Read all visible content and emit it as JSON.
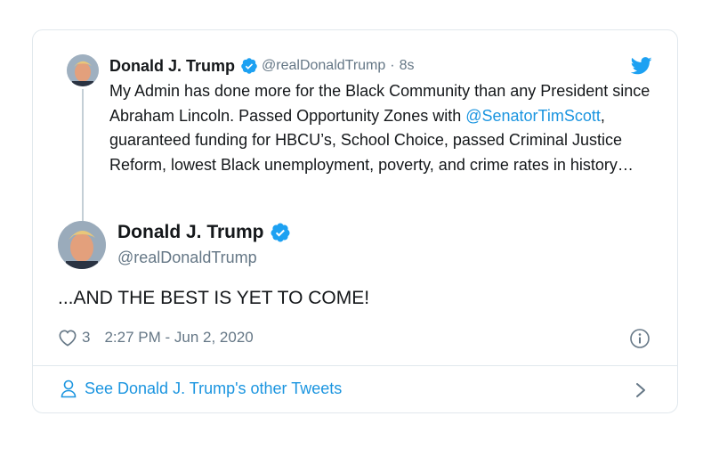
{
  "quoted": {
    "name": "Donald J. Trump",
    "handle": "@realDonaldTrump",
    "separator": "·",
    "time": "8s",
    "text_before": "My Admin has done more for the Black Community than any President since Abraham Lincoln. Passed Opportunity Zones with ",
    "mention": "@SenatorTimScott",
    "text_after": ", guaranteed funding for HBCU’s, School Choice, passed Criminal Justice Reform, lowest Black unemployment, poverty, and crime rates in history…"
  },
  "tweet": {
    "name": "Donald J. Trump",
    "handle": "@realDonaldTrump",
    "text": "...AND THE BEST IS YET TO COME!",
    "like_count": "3",
    "timestamp": "2:27 PM - Jun 2, 2020"
  },
  "footer": {
    "link_label": "See Donald J. Trump's other Tweets"
  },
  "icons": {
    "verified": "verified-badge-icon",
    "brand": "twitter-bird-icon",
    "like": "heart-icon",
    "info": "info-icon",
    "profile": "person-icon",
    "next": "chevron-right-icon"
  },
  "colors": {
    "accent": "#1da1f2",
    "link": "#1b95e0",
    "secondary_text": "#657786",
    "border": "#e1e8ed"
  }
}
